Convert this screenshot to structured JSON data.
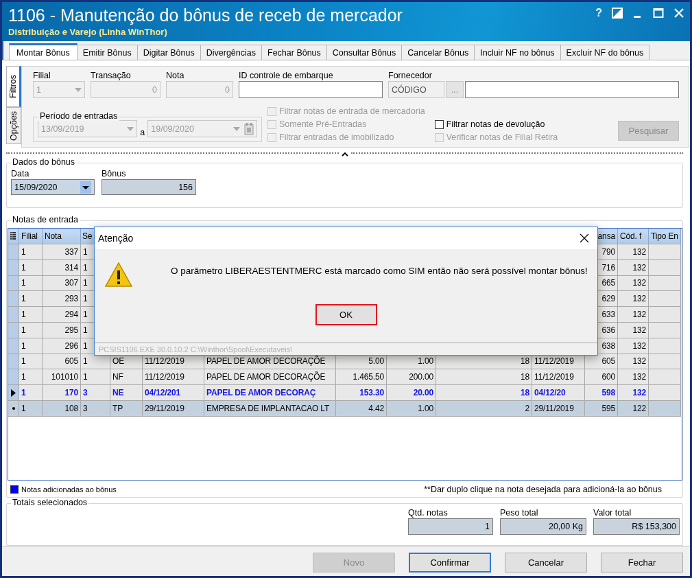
{
  "window": {
    "title": "1106 - Manutenção do bônus de receb de mercador",
    "subtitle": "Distribuição e Varejo (Linha WinThor)",
    "help": "?"
  },
  "tabs": [
    {
      "label": "Montar Bônus",
      "selected": true
    },
    {
      "label": "Emitir Bônus",
      "selected": false
    },
    {
      "label": "Digitar Bônus",
      "selected": false
    },
    {
      "label": "Divergências",
      "selected": false
    },
    {
      "label": "Fechar Bônus",
      "selected": false
    },
    {
      "label": "Consultar Bônus",
      "selected": false
    },
    {
      "label": "Cancelar Bônus",
      "selected": false
    },
    {
      "label": "Incluir NF no bônus",
      "selected": false
    },
    {
      "label": "Excluir NF do bônus",
      "selected": false
    }
  ],
  "side_tabs": [
    {
      "label": "Filtros",
      "selected": true
    },
    {
      "label": "Opções",
      "selected": false
    }
  ],
  "filters": {
    "fields": [
      {
        "label": "Filial",
        "value": "1",
        "disabled": true,
        "kind": "dropdown"
      },
      {
        "label": "Transação",
        "value": "0",
        "disabled": true,
        "kind": "number"
      },
      {
        "label": "Nota",
        "value": "0",
        "disabled": true,
        "kind": "number"
      },
      {
        "label": "ID controle de embarque",
        "disabled": false,
        "kind": "text"
      }
    ],
    "fornecedor": {
      "label": "Fornecedor",
      "code": "CÓDIGO",
      "button": "..."
    },
    "periodo": {
      "label": "Período de entradas",
      "from": "13/09/2019",
      "separator": "a",
      "to": "19/09/2020",
      "disabled": true
    },
    "checkbox_columns": [
      [
        {
          "label": "Filtrar notas de entrada de mercadoria",
          "checked": false,
          "disabled": true
        },
        {
          "label": "Somente Pré-Entradas",
          "checked": false,
          "disabled": true
        },
        {
          "label": "Filtrar entradas de imobilizado",
          "checked": false,
          "disabled": true
        }
      ],
      [
        {
          "label": "Filtrar notas de devolução",
          "checked": false,
          "disabled": false
        },
        {
          "label": "Verificar notas de Filial Retira",
          "checked": false,
          "disabled": true
        }
      ]
    ],
    "search_button": {
      "label": "Pesquisar",
      "disabled": true
    }
  },
  "dados_bonus": {
    "title": "Dados do bônus",
    "data": {
      "label": "Data",
      "value": "15/09/2020"
    },
    "bonus": {
      "label": "Bônus",
      "value": "156"
    }
  },
  "notas": {
    "title": "Notas de entrada",
    "columns": {
      "column_1": "Filial",
      "column_2": "Nota",
      "column_3": "Se",
      "column_11": "ansa",
      "column_12": "Cód. f",
      "column_13": "Tipo En"
    },
    "rows": [
      {
        "current": false,
        "added": false,
        "selected": false,
        "cells": {
          "column_1": "1",
          "column_2": "337",
          "column_3": "1",
          "column_11": "790",
          "column_12": "132"
        }
      },
      {
        "current": false,
        "added": false,
        "selected": false,
        "cells": {
          "column_1": "1",
          "column_2": "314",
          "column_3": "1",
          "column_11": "716",
          "column_12": "132"
        }
      },
      {
        "current": false,
        "added": false,
        "selected": false,
        "cells": {
          "column_1": "1",
          "column_2": "307",
          "column_3": "1",
          "column_11": "665",
          "column_12": "132"
        }
      },
      {
        "current": false,
        "added": false,
        "selected": false,
        "cells": {
          "column_1": "1",
          "column_2": "293",
          "column_3": "1",
          "column_11": "629",
          "column_12": "132"
        }
      },
      {
        "current": false,
        "added": false,
        "selected": false,
        "cells": {
          "column_1": "1",
          "column_2": "294",
          "column_3": "1",
          "column_11": "633",
          "column_12": "132"
        }
      },
      {
        "current": false,
        "added": false,
        "selected": false,
        "cells": {
          "column_1": "1",
          "column_2": "295",
          "column_3": "1",
          "column_11": "636",
          "column_12": "132"
        }
      },
      {
        "current": false,
        "added": false,
        "selected": false,
        "cells": {
          "column_1": "1",
          "column_2": "296",
          "column_3": "1",
          "column_11": "638",
          "column_12": "132"
        }
      },
      {
        "current": false,
        "added": false,
        "selected": false,
        "cells": {
          "column_1": "1",
          "column_2": "605",
          "column_3": "1",
          "column_4": "OE",
          "column_5": "11/12/2019",
          "column_6": "PAPEL DE AMOR DECORAÇÕE",
          "column_7": "5.00",
          "column_8": "1.00",
          "column_9": "18",
          "column_10": "11/12/2019",
          "column_11": "605",
          "column_12": "132"
        }
      },
      {
        "current": false,
        "added": false,
        "selected": false,
        "cells": {
          "column_1": "1",
          "column_2": "101010",
          "column_3": "1",
          "column_4": "NF",
          "column_5": "11/12/2019",
          "column_6": "PAPEL DE AMOR DECORAÇÕE",
          "column_7": "1.465.50",
          "column_8": "200.00",
          "column_9": "18",
          "column_10": "11/12/2019",
          "column_11": "600",
          "column_12": "132"
        }
      },
      {
        "current": true,
        "added": true,
        "selected": false,
        "cells": {
          "column_1": "1",
          "column_2": "170",
          "column_3": "3",
          "column_4": "NE",
          "column_5": "04/12/201",
          "column_6": "PAPEL DE AMOR DECORAÇ",
          "column_7": "153.30",
          "column_8": "20.00",
          "column_9": "18",
          "column_10": "04/12/20",
          "column_11": "598",
          "column_12": "132"
        }
      },
      {
        "current": false,
        "added": false,
        "selected": true,
        "cells": {
          "column_1": "1",
          "column_2": "108",
          "column_3": "3",
          "column_4": "TP",
          "column_5": "29/11/2019",
          "column_6": "EMPRESA DE IMPLANTACAO LT",
          "column_7": "4.42",
          "column_8": "1.00",
          "column_9": "2",
          "column_10": "29/11/2019",
          "column_11": "595",
          "column_12": "122"
        }
      }
    ],
    "legend": "Notas adicionadas ao bônus",
    "hint": "**Dar duplo clique na nota desejada para adicioná-la ao bônus"
  },
  "dialog": {
    "title": "Atenção",
    "message": "O parâmetro LIBERAESTENTMERC está marcado como SIM então não será possível montar bônus!",
    "button": "OK",
    "footer": "PCSIS1106.EXE 30.0.10.2 C:\\Winthor\\Spool\\Executaveis\\"
  },
  "totais": {
    "title": "Totais selecionados",
    "fields": [
      {
        "label": "Qtd. notas",
        "value": "1"
      },
      {
        "label": "Peso total",
        "value": "20,00 Kg"
      },
      {
        "label": "Valor total",
        "value": "R$ 153,300"
      }
    ]
  },
  "buttons": [
    {
      "label": "Novo",
      "disabled": true,
      "focused": false
    },
    {
      "label": "Confirmar",
      "disabled": false,
      "focused": true
    },
    {
      "label": "Cancelar",
      "disabled": false,
      "focused": false
    },
    {
      "label": "Fechar",
      "disabled": false,
      "focused": false
    }
  ]
}
